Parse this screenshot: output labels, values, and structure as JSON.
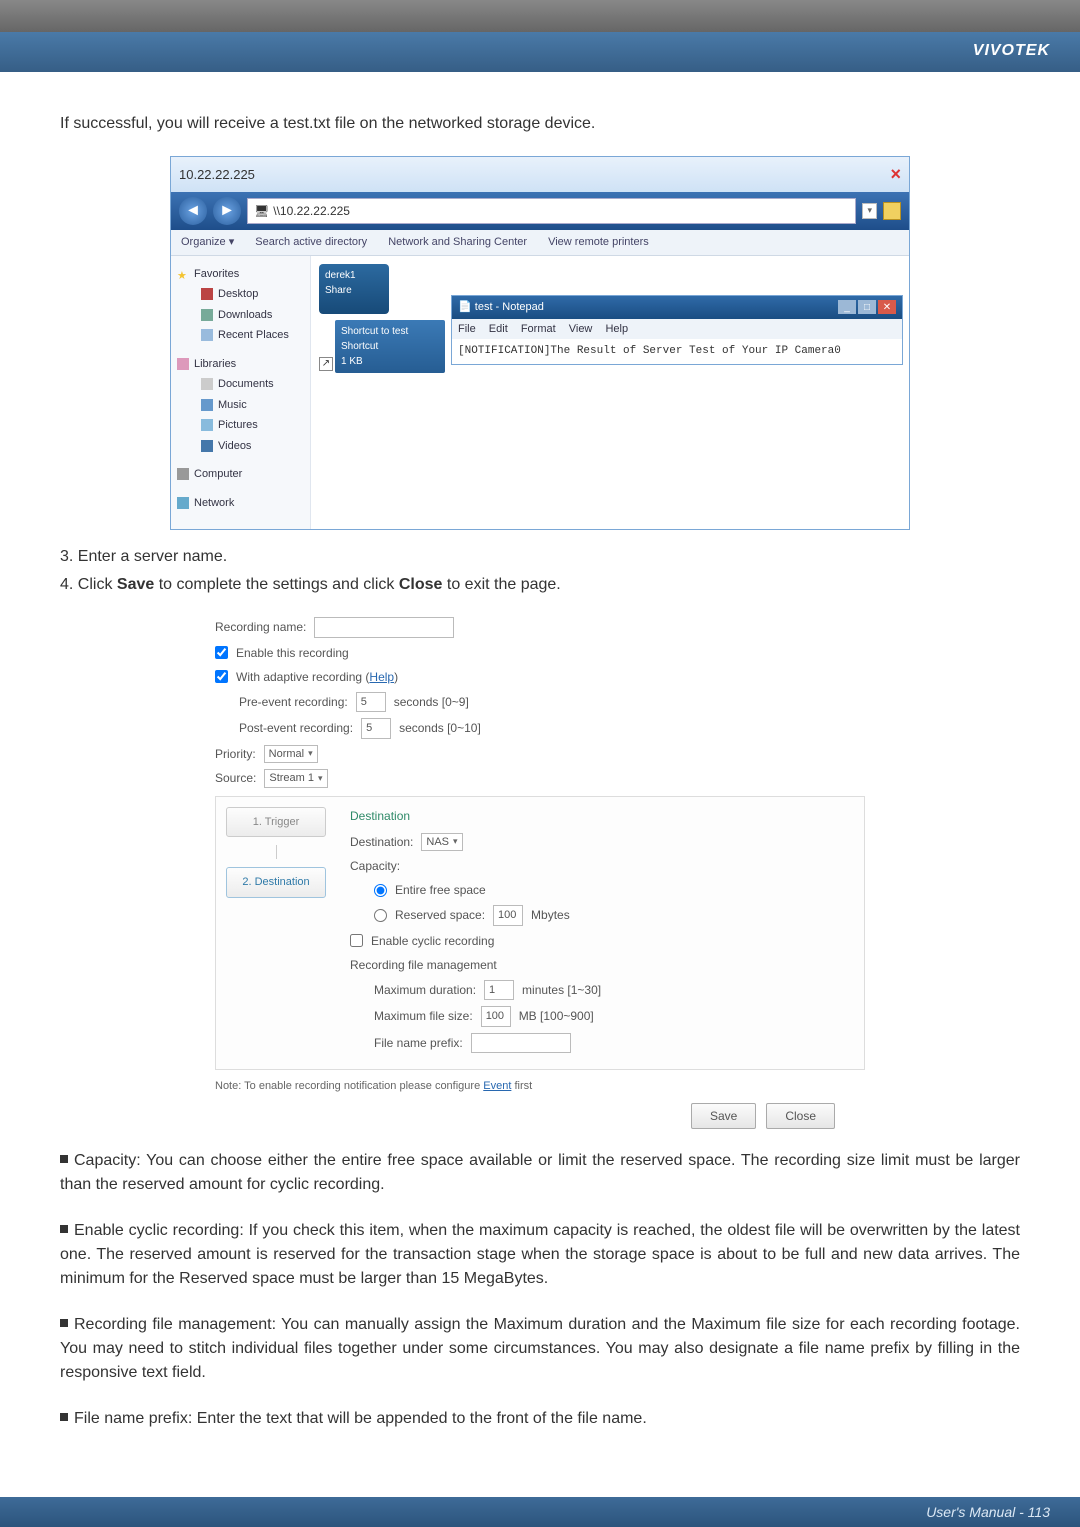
{
  "header": {
    "brand": "VIVOTEK"
  },
  "intro": "If successful, you will receive a test.txt file on the networked storage device.",
  "explorer": {
    "title": "10.22.22.225",
    "address_prefix": "\\\\10.22.22.225",
    "toolbar": {
      "organize": "Organize  ▾",
      "search": "Search active directory",
      "network": "Network and Sharing Center",
      "printers": "View remote printers"
    },
    "sidebar": {
      "favorites": "Favorites",
      "desktop": "Desktop",
      "downloads": "Downloads",
      "recent": "Recent Places",
      "libraries": "Libraries",
      "documents": "Documents",
      "music": "Music",
      "pictures": "Pictures",
      "videos": "Videos",
      "computer": "Computer",
      "network": "Network"
    },
    "share": {
      "line1": "derek1",
      "line2": "Share"
    },
    "shortcut": {
      "line1": "Shortcut to test",
      "line2": "Shortcut",
      "line3": "1 KB"
    }
  },
  "notepad": {
    "title": "test - Notepad",
    "menu": {
      "file": "File",
      "edit": "Edit",
      "format": "Format",
      "view": "View",
      "help": "Help"
    },
    "body": "[NOTIFICATION]The Result of Server Test of Your IP Camera0"
  },
  "steps": {
    "s3": "3. Enter a server name.",
    "s4_a": "4. Click ",
    "s4_save": "Save",
    "s4_b": " to complete the settings and click ",
    "s4_close": "Close",
    "s4_c": " to exit the page."
  },
  "form": {
    "recording_name_label": "Recording name:",
    "enable_recording": "Enable this recording",
    "adaptive_recording": "With adaptive recording (",
    "help": "Help",
    "adaptive_recording_end": ")",
    "pre_label": "Pre-event recording:",
    "pre_val": "5",
    "pre_hint": "seconds [0~9]",
    "post_label": "Post-event recording:",
    "post_val": "5",
    "post_hint": "seconds [0~10]",
    "priority_label": "Priority:",
    "priority_val": "Normal",
    "source_label": "Source:",
    "source_val": "Stream 1",
    "tab_trigger": "1.  Trigger",
    "tab_destination": "2.  Destination",
    "sec_destination": "Destination",
    "dest_label": "Destination:",
    "dest_val": "NAS",
    "capacity_label": "Capacity:",
    "entire": "Entire free space",
    "reserved_label": "Reserved space:",
    "reserved_val": "100",
    "reserved_unit": "Mbytes",
    "cyclic": "Enable cyclic recording",
    "rfm": "Recording file management",
    "maxdur_label": "Maximum duration:",
    "maxdur_val": "1",
    "maxdur_hint": "minutes [1~30]",
    "maxsize_label": "Maximum file size:",
    "maxsize_val": "100",
    "maxsize_hint": "MB [100~900]",
    "prefix_label": "File name prefix:",
    "note_a": "Note: To enable recording notification please configure ",
    "note_link": "Event",
    "note_b": " first",
    "save_btn": "Save",
    "close_btn": "Close"
  },
  "bullets": {
    "b1": "Capacity: You can choose either the entire free space available or limit the reserved space. The recording size limit must be larger than the reserved amount for cyclic recording.",
    "b2": "Enable cyclic recording: If you check this item, when the maximum capacity is reached, the oldest file will be overwritten by the latest one. The reserved amount is reserved for the transaction stage when the storage space is about to be full and new data arrives. The minimum for the Reserved space must be larger than 15 MegaBytes.",
    "b3": "Recording file management: You can manually assign the Maximum duration and the Maximum file size for each recording footage. You may need to stitch individual files together under some circumstances. You may also designate a file name prefix by filling in the responsive text field.",
    "b4": "File name prefix: Enter the text that will be appended to the front of the file name."
  },
  "footer": {
    "text": "User's Manual - 113"
  }
}
